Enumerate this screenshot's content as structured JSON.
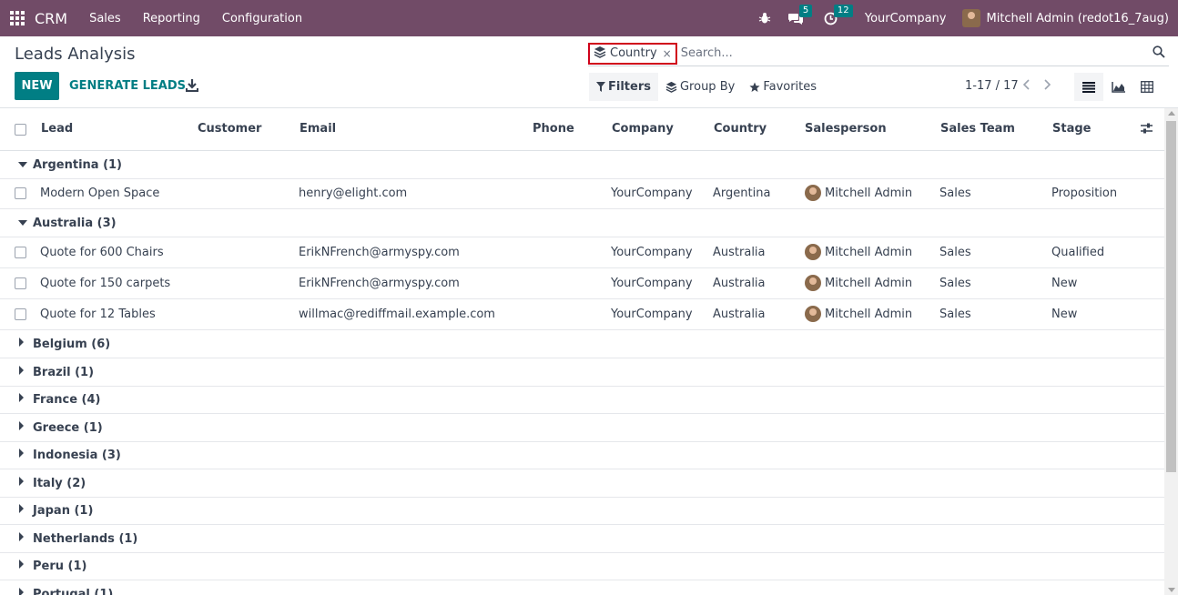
{
  "navbar": {
    "brand": "CRM",
    "menus": [
      "Sales",
      "Reporting",
      "Configuration"
    ],
    "messages_badge": "5",
    "activities_badge": "12",
    "company": "YourCompany",
    "user": "Mitchell Admin (redot16_7aug)"
  },
  "page": {
    "title": "Leads Analysis",
    "new_label": "NEW",
    "generate_label": "GENERATE LEADS"
  },
  "search": {
    "facet_label": "Country",
    "facet_remove": "×",
    "placeholder": "Search..."
  },
  "filters": {
    "filters_label": "Filters",
    "groupby_label": "Group By",
    "favorites_label": "Favorites"
  },
  "pager": {
    "value": "1-17 / 17"
  },
  "table": {
    "columns": {
      "lead": "Lead",
      "customer": "Customer",
      "email": "Email",
      "phone": "Phone",
      "company": "Company",
      "country": "Country",
      "salesperson": "Salesperson",
      "sales_team": "Sales Team",
      "stage": "Stage"
    },
    "groups": [
      {
        "label": "Argentina (1)",
        "expanded": true,
        "records": [
          {
            "lead": "Modern Open Space",
            "customer": "",
            "email": "henry@elight.com",
            "phone": "",
            "company": "YourCompany",
            "country": "Argentina",
            "salesperson": "Mitchell Admin",
            "sales_team": "Sales",
            "stage": "Proposition"
          }
        ]
      },
      {
        "label": "Australia (3)",
        "expanded": true,
        "records": [
          {
            "lead": "Quote for 600 Chairs",
            "customer": "",
            "email": "ErikNFrench@armyspy.com",
            "phone": "",
            "company": "YourCompany",
            "country": "Australia",
            "salesperson": "Mitchell Admin",
            "sales_team": "Sales",
            "stage": "Qualified"
          },
          {
            "lead": "Quote for 150 carpets",
            "customer": "",
            "email": "ErikNFrench@armyspy.com",
            "phone": "",
            "company": "YourCompany",
            "country": "Australia",
            "salesperson": "Mitchell Admin",
            "sales_team": "Sales",
            "stage": "New"
          },
          {
            "lead": "Quote for 12 Tables",
            "customer": "",
            "email": "willmac@rediffmail.example.com",
            "phone": "",
            "company": "YourCompany",
            "country": "Australia",
            "salesperson": "Mitchell Admin",
            "sales_team": "Sales",
            "stage": "New"
          }
        ]
      },
      {
        "label": "Belgium (6)",
        "expanded": false,
        "records": []
      },
      {
        "label": "Brazil (1)",
        "expanded": false,
        "records": []
      },
      {
        "label": "France (4)",
        "expanded": false,
        "records": []
      },
      {
        "label": "Greece (1)",
        "expanded": false,
        "records": []
      },
      {
        "label": "Indonesia (3)",
        "expanded": false,
        "records": []
      },
      {
        "label": "Italy (2)",
        "expanded": false,
        "records": []
      },
      {
        "label": "Japan (1)",
        "expanded": false,
        "records": []
      },
      {
        "label": "Netherlands (1)",
        "expanded": false,
        "records": []
      },
      {
        "label": "Peru (1)",
        "expanded": false,
        "records": []
      },
      {
        "label": "Portugal (1)",
        "expanded": false,
        "records": []
      }
    ]
  },
  "colors": {
    "navbar": "#714b67",
    "primary": "#017e84",
    "highlight_border": "#d0021b"
  }
}
